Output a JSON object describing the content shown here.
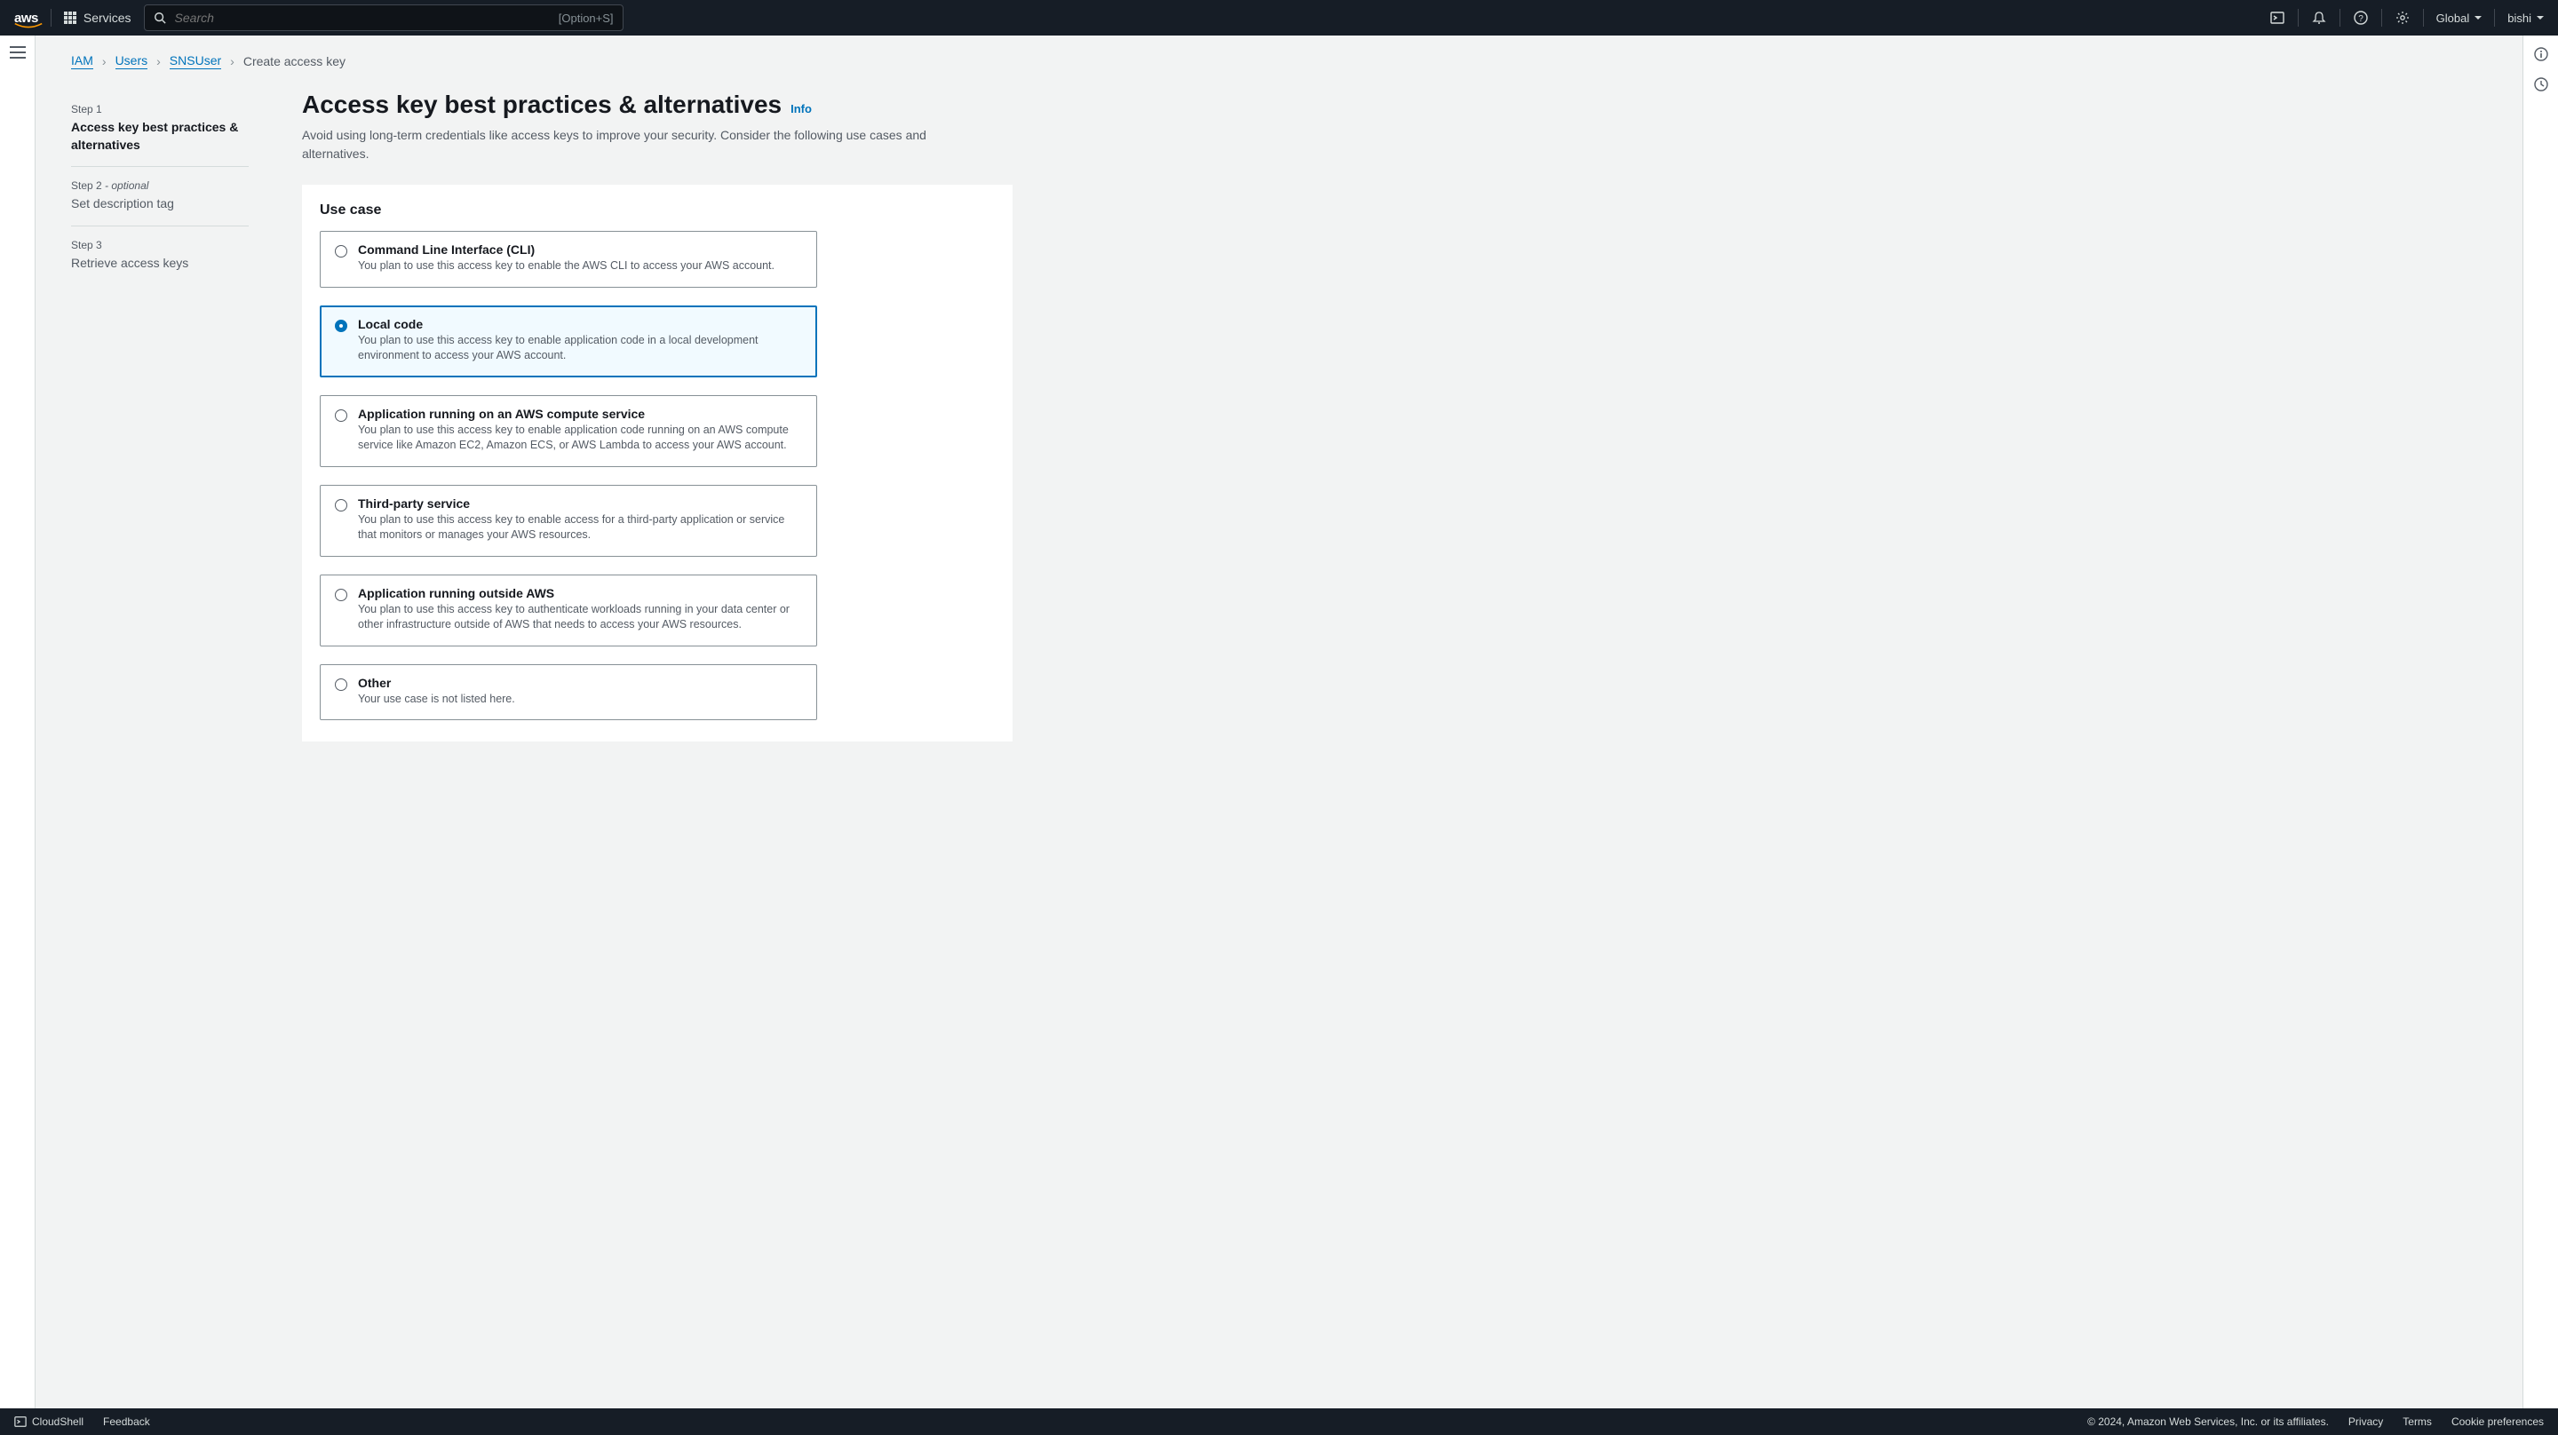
{
  "topnav": {
    "logo": "aws",
    "services": "Services",
    "search_placeholder": "Search",
    "search_hint": "[Option+S]",
    "region": "Global",
    "account": "bishi"
  },
  "breadcrumbs": {
    "items": [
      "IAM",
      "Users",
      "SNSUser"
    ],
    "current": "Create access key"
  },
  "steps": [
    {
      "label": "Step 1",
      "optional": "",
      "title": "Access key best practices & alternatives",
      "active": true
    },
    {
      "label": "Step 2",
      "optional": " - optional",
      "title": "Set description tag",
      "active": false
    },
    {
      "label": "Step 3",
      "optional": "",
      "title": "Retrieve access keys",
      "active": false
    }
  ],
  "page": {
    "title": "Access key best practices & alternatives",
    "info": "Info",
    "subtitle": "Avoid using long-term credentials like access keys to improve your security. Consider the following use cases and alternatives."
  },
  "panel": {
    "heading": "Use case",
    "options": [
      {
        "title": "Command Line Interface (CLI)",
        "desc": "You plan to use this access key to enable the AWS CLI to access your AWS account.",
        "selected": false
      },
      {
        "title": "Local code",
        "desc": "You plan to use this access key to enable application code in a local development environment to access your AWS account.",
        "selected": true
      },
      {
        "title": "Application running on an AWS compute service",
        "desc": "You plan to use this access key to enable application code running on an AWS compute service like Amazon EC2, Amazon ECS, or AWS Lambda to access your AWS account.",
        "selected": false
      },
      {
        "title": "Third-party service",
        "desc": "You plan to use this access key to enable access for a third-party application or service that monitors or manages your AWS resources.",
        "selected": false
      },
      {
        "title": "Application running outside AWS",
        "desc": "You plan to use this access key to authenticate workloads running in your data center or other infrastructure outside of AWS that needs to access your AWS resources.",
        "selected": false
      },
      {
        "title": "Other",
        "desc": "Your use case is not listed here.",
        "selected": false
      }
    ]
  },
  "footer": {
    "cloudshell": "CloudShell",
    "feedback": "Feedback",
    "copyright": "© 2024, Amazon Web Services, Inc. or its affiliates.",
    "privacy": "Privacy",
    "terms": "Terms",
    "cookies": "Cookie preferences"
  }
}
